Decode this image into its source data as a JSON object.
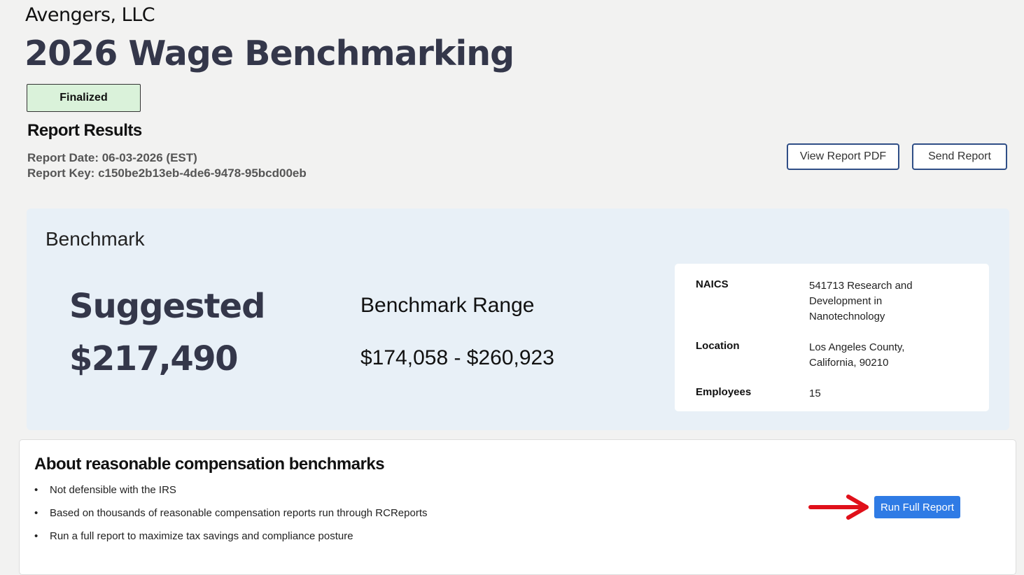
{
  "header": {
    "company": "Avengers, LLC",
    "title": "2026 Wage Benchmarking",
    "status": "Finalized"
  },
  "results": {
    "heading": "Report Results",
    "date": "Report Date: 06-03-2026 (EST)",
    "key": "Report Key: c150be2b13eb-4de6-9478-95bcd00eb",
    "view_pdf_label": "View Report PDF",
    "send_label": "Send Report"
  },
  "benchmark": {
    "heading": "Benchmark",
    "suggested_label": "Suggested",
    "suggested_value": "$217,490",
    "range_label": "Benchmark Range",
    "range_value": "$174,058 - $260,923"
  },
  "info": {
    "naics_label": "NAICS",
    "naics_value": "541713 Research and Development in Nanotechnology",
    "location_label": "Location",
    "location_value": "Los Angeles County, California, 90210",
    "employees_label": "Employees",
    "employees_value": "15"
  },
  "about": {
    "heading": "About reasonable compensation benchmarks",
    "items": [
      "Not defensible with the IRS",
      "Based on thousands of reasonable compensation reports run through RCReports",
      "Run a full report to maximize tax savings and compliance posture"
    ],
    "run_label": "Run Full Report"
  },
  "colors": {
    "accent": "#2f7be5",
    "arrow": "#e0101a",
    "badge_bg": "#daf2da",
    "panel_bg": "#e8f0f7"
  }
}
